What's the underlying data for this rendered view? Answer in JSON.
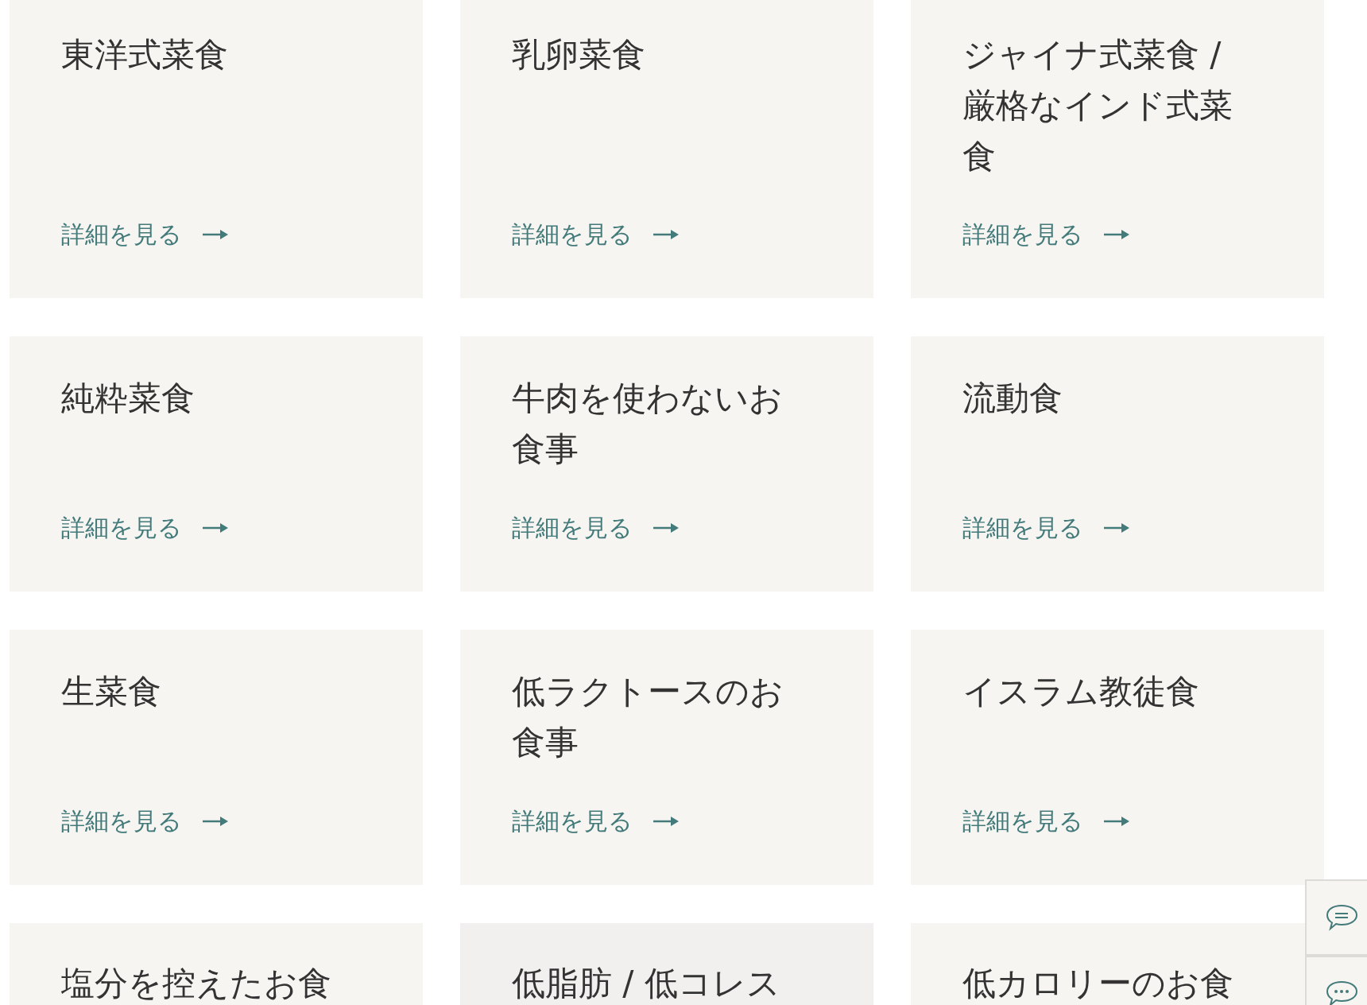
{
  "cards": [
    {
      "title": "東洋式菜食",
      "link": "詳細を見る",
      "color": "#f6f5f1"
    },
    {
      "title": "乳卵菜食",
      "link": "詳細を見る",
      "color": "#f6f5f1"
    },
    {
      "title": "ジャイナ式菜食 / 厳格なインド式菜食",
      "link": "詳細を見る",
      "color": "#f6f5f1"
    },
    {
      "title": "純粋菜食",
      "link": "詳細を見る",
      "color": "#f6f5f1"
    },
    {
      "title": "牛肉を使わないお食事",
      "link": "詳細を見る",
      "color": "#f6f5f1"
    },
    {
      "title": "流動食",
      "link": "詳細を見る",
      "color": "#f6f5f1"
    },
    {
      "title": "生菜食",
      "link": "詳細を見る",
      "color": "#f6f5f1"
    },
    {
      "title": "低ラクトースのお食事",
      "link": "詳細を見る",
      "color": "#f6f5f1"
    },
    {
      "title": "イスラム教徒食",
      "link": "詳細を見る",
      "color": "#f6f5f1"
    },
    {
      "title": "塩分を控えたお食",
      "color": "#f6f5f1"
    },
    {
      "title": "低脂肪 / 低コレス",
      "color": "#f1f0ee"
    },
    {
      "title": "低カロリーのお食",
      "color": "#f6f5f1"
    }
  ],
  "side_buttons": [
    {
      "kind": "lines"
    },
    {
      "kind": "dots"
    }
  ]
}
